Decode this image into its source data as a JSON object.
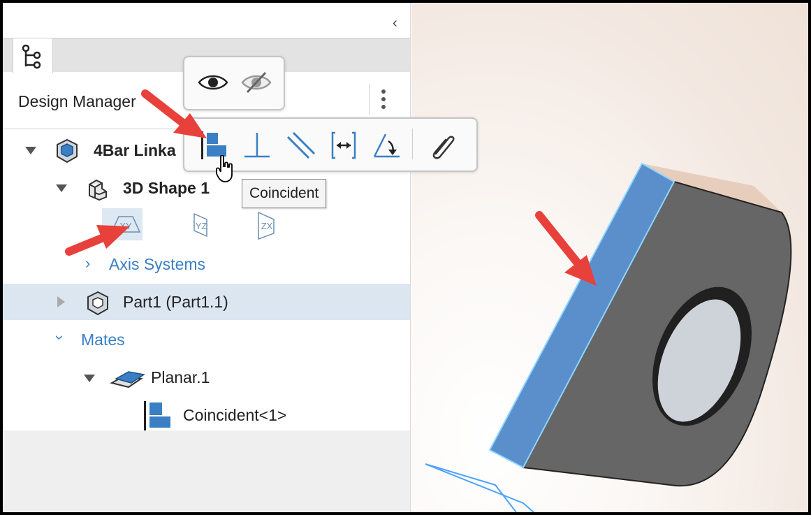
{
  "panel": {
    "title": "Design Manager",
    "collapse_glyph": "‹",
    "tree": {
      "root": "4Bar Linka",
      "shape": "3D Shape 1",
      "planes": [
        "XY",
        "YZ",
        "ZX"
      ],
      "axis_systems": "Axis Systems",
      "part": "Part1 (Part1.1)",
      "mates": "Mates",
      "planar": "Planar.1",
      "coincident_item": "Coincident<1>"
    }
  },
  "visibility_popup": {
    "icons": [
      "eye-icon",
      "eye-hidden-icon"
    ]
  },
  "mate_toolbar": {
    "tools": [
      "coincident-icon",
      "perpendicular-icon",
      "parallel-icon",
      "distance-icon",
      "angle-icon",
      "attach-icon"
    ],
    "tooltip": "Coincident"
  },
  "colors": {
    "accent": "#3a7fc4",
    "selection": "#dbe6f0",
    "face_blue": "#5a8fcc",
    "body_gray": "#656565",
    "arrow_red": "#e8403a"
  }
}
